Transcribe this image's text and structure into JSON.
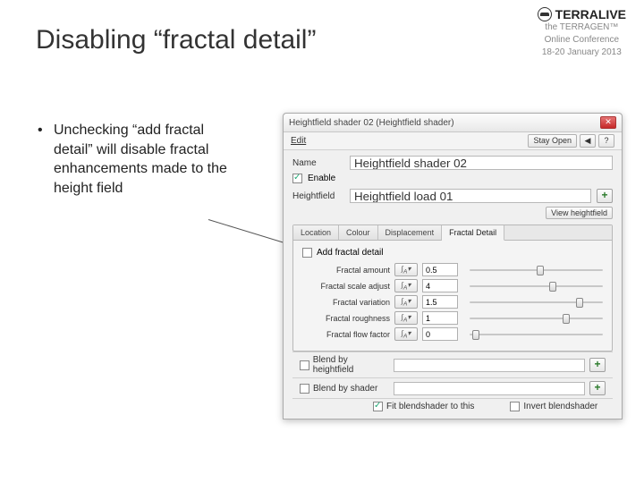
{
  "slide": {
    "title": "Disabling “fractal detail”",
    "bullet": "Unchecking “add fractal detail” will disable fractal enhancements made to the height field"
  },
  "brand": {
    "name": "TERRALIVE",
    "line1": "the TERRAGEN™",
    "line2": "Online Conference",
    "line3": "18-20 January 2013"
  },
  "window": {
    "title": "Heightfield shader 02    (Heightfield shader)",
    "menu_edit": "Edit",
    "btn_stayopen": "Stay Open",
    "btn_back": "◀",
    "btn_help": "?",
    "name_label": "Name",
    "name_value": "Heightfield shader 02",
    "enable_label": "Enable",
    "heightfield_label": "Heightfield",
    "heightfield_value": "Heightfield load 01",
    "view_heightfield": "View heightfield",
    "tabs": {
      "location": "Location",
      "colour": "Colour",
      "displacement": "Displacement",
      "fractal": "Fractal Detail"
    },
    "fractal": {
      "add_detail": "Add fractal detail",
      "params": [
        {
          "label": "Fractal amount",
          "value": "0.5",
          "pos": 50
        },
        {
          "label": "Fractal scale adjust",
          "value": "4",
          "pos": 60
        },
        {
          "label": "Fractal variation",
          "value": "1.5",
          "pos": 80
        },
        {
          "label": "Fractal roughness",
          "value": "1",
          "pos": 70
        },
        {
          "label": "Fractal flow factor",
          "value": "0",
          "pos": 2
        }
      ]
    },
    "blend_heightfield": "Blend by heightfield",
    "blend_shader": "Blend by shader",
    "fit_blendshader": "Fit blendshader to this",
    "invert_blendshader": "Invert blendshader"
  }
}
